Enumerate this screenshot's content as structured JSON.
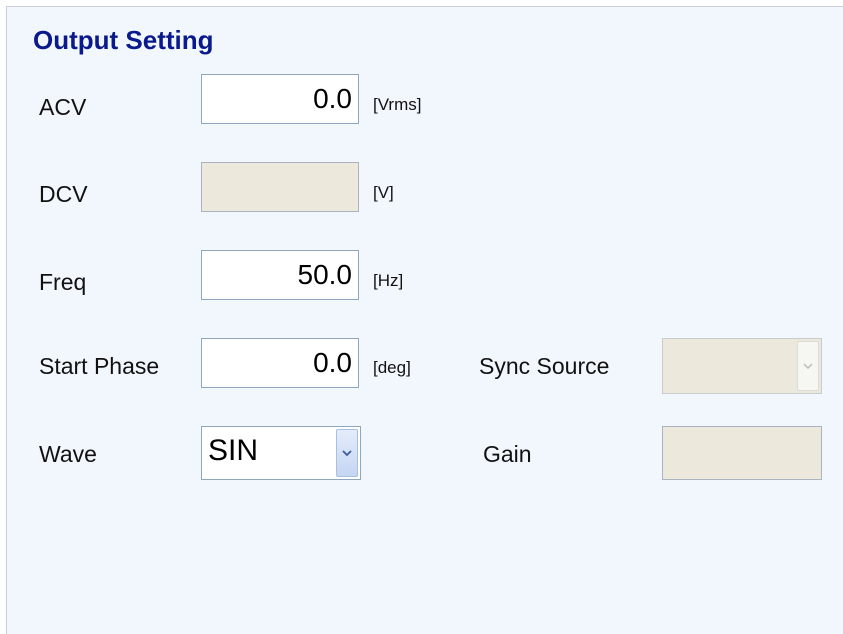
{
  "panel": {
    "title": "Output Setting"
  },
  "fields": {
    "acv": {
      "label": "ACV",
      "value": "0.0",
      "unit": "[Vrms]",
      "enabled": true
    },
    "dcv": {
      "label": "DCV",
      "value": "",
      "unit": "[V]",
      "enabled": false
    },
    "freq": {
      "label": "Freq",
      "value": "50.0",
      "unit": "[Hz]",
      "enabled": true
    },
    "start_phase": {
      "label": "Start Phase",
      "value": "0.0",
      "unit": "[deg]",
      "enabled": true
    },
    "wave": {
      "label": "Wave",
      "selected": "SIN",
      "enabled": true
    },
    "sync_source": {
      "label": "Sync Source",
      "selected": "",
      "enabled": false
    },
    "gain": {
      "label": "Gain",
      "value": "",
      "enabled": false
    }
  },
  "icons": {
    "dropdown_arrow": "chevron-down-icon"
  },
  "colors": {
    "title": "#0a1a8c",
    "panel_background": "#f2f7fd",
    "disabled_field": "#ece9dc",
    "field_border": "#8fa6bf"
  }
}
